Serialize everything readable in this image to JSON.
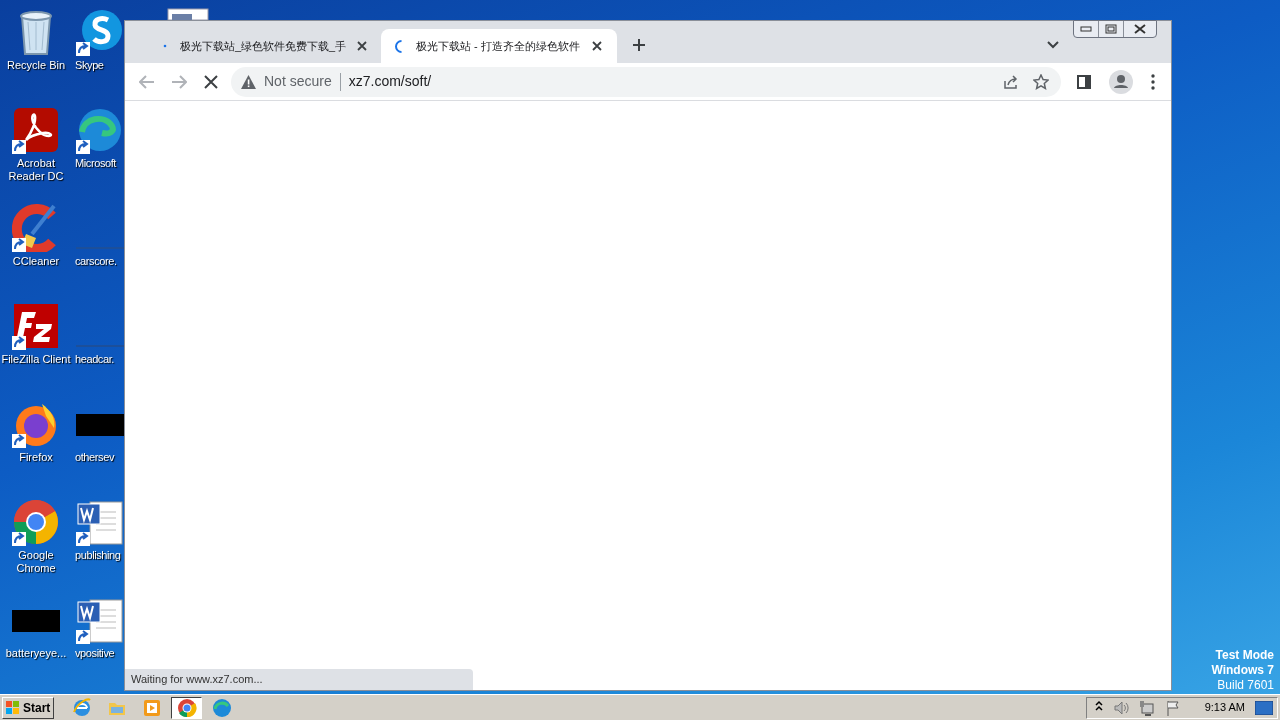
{
  "desktop": {
    "columns": [
      [
        {
          "label": "Recycle Bin",
          "kind": "bin"
        },
        {
          "label": "Acrobat Reader DC",
          "kind": "acrobat"
        },
        {
          "label": "CCleaner",
          "kind": "ccleaner"
        },
        {
          "label": "FileZilla Client",
          "kind": "filezilla"
        },
        {
          "label": "Firefox",
          "kind": "firefox"
        },
        {
          "label": "Google Chrome",
          "kind": "chrome"
        },
        {
          "label": "batteryeye...",
          "kind": "black"
        }
      ],
      [
        {
          "label": "Skype",
          "kind": "skype"
        },
        {
          "label": "Microsoft",
          "kind": "edge"
        },
        {
          "label": "carscore.",
          "kind": "blank"
        },
        {
          "label": "headcar.",
          "kind": "blank"
        },
        {
          "label": "othersev",
          "kind": "black"
        },
        {
          "label": "publishing",
          "kind": "word"
        },
        {
          "label": "vpositive",
          "kind": "word"
        }
      ],
      [
        {
          "kind": "file"
        }
      ]
    ],
    "watermark_lines": [
      "Test Mode",
      "Windows 7",
      "Build 7601"
    ]
  },
  "browser": {
    "tabs": [
      {
        "title": "极光下载站_绿色软件免费下载_手",
        "selected": false,
        "kind": "dot"
      },
      {
        "title": "极光下载站 - 打造齐全的绿色软件",
        "selected": true,
        "kind": "spinner"
      }
    ],
    "security_label": "Not secure",
    "url": "xz7.com/soft/",
    "status_bubble": "Waiting for www.xz7.com..."
  },
  "taskbar": {
    "start_label": "Start",
    "items": [
      {
        "kind": "ie",
        "selected": false
      },
      {
        "kind": "folder",
        "selected": false
      },
      {
        "kind": "media",
        "selected": false
      },
      {
        "kind": "chrome",
        "selected": true
      },
      {
        "kind": "edge",
        "selected": false
      }
    ],
    "clock": "9:13 AM"
  }
}
